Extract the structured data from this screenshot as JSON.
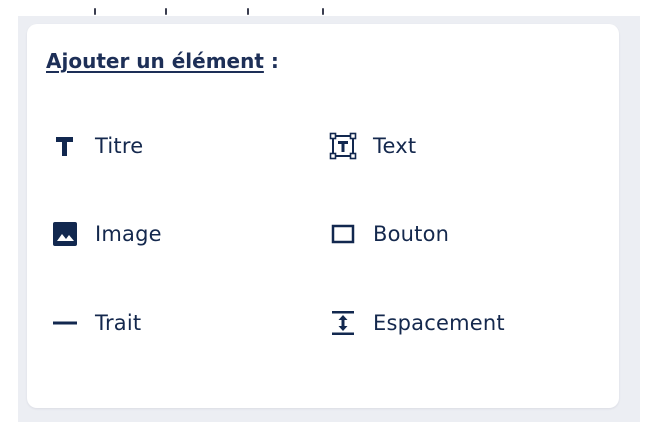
{
  "panel": {
    "heading_link": "Ajouter un élément",
    "heading_suffix": " :"
  },
  "items": [
    {
      "label": "Titre",
      "icon": "title-t-icon"
    },
    {
      "label": "Text",
      "icon": "text-box-icon"
    },
    {
      "label": "Image",
      "icon": "image-icon"
    },
    {
      "label": "Bouton",
      "icon": "button-rectangle-icon"
    },
    {
      "label": "Trait",
      "icon": "horizontal-line-icon"
    },
    {
      "label": "Espacement",
      "icon": "vertical-spacing-icon"
    }
  ],
  "colors": {
    "text": "#14284d",
    "icon": "#12284f",
    "backdrop": "#eceef3",
    "card": "#ffffff"
  }
}
